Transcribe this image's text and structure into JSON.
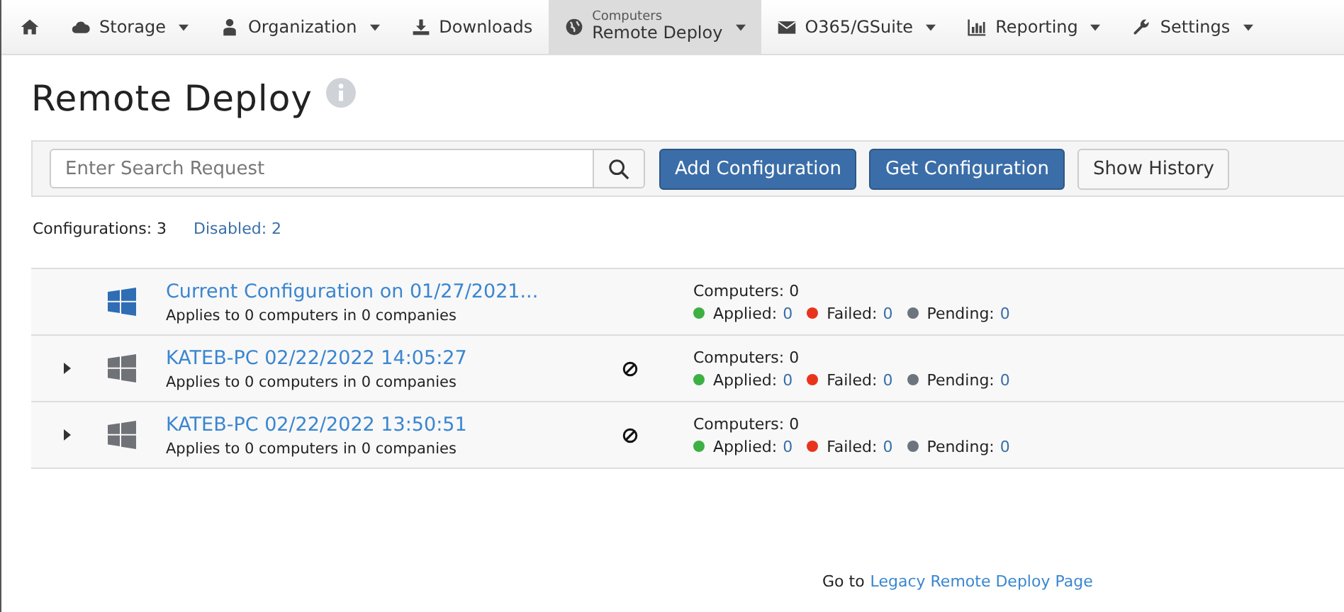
{
  "nav": [
    {
      "caret": false,
      "selected": false
    },
    {
      "label": "Storage",
      "caret": true,
      "selected": false
    },
    {
      "label": "Organization",
      "caret": true,
      "selected": false
    },
    {
      "label": "Downloads",
      "caret": false,
      "selected": false
    },
    {
      "sublabel": "Computers",
      "label": "Remote Deploy",
      "caret": true,
      "selected": true
    },
    {
      "label": "O365/GSuite",
      "caret": true,
      "selected": false
    },
    {
      "label": "Reporting",
      "caret": true,
      "selected": false
    },
    {
      "label": "Settings",
      "caret": true,
      "selected": false
    }
  ],
  "page": {
    "title": "Remote Deploy"
  },
  "toolbar": {
    "search": {
      "placeholder": "Enter Search Request"
    },
    "buttons": [
      {
        "label": "Add Configuration",
        "kind": "primary"
      },
      {
        "label": "Get Configuration",
        "kind": "primary"
      },
      {
        "label": "Show History",
        "kind": "default"
      }
    ]
  },
  "counts": {
    "configurations": "Configurations: 3",
    "disabled": "Disabled: 2"
  },
  "configs": [
    {
      "title": "Current Configuration on 01/27/2021...",
      "applies": "Applies to 0 computers in 0 companies",
      "expandable": false,
      "disabled": false,
      "computers": "Computers: 0",
      "statuses": [
        {
          "label": "Applied:",
          "count": "0",
          "color": "#3cb043"
        },
        {
          "label": "Failed:",
          "count": "0",
          "color": "#e8341c"
        },
        {
          "label": "Pending:",
          "count": "0",
          "color": "#6c757d"
        }
      ]
    },
    {
      "title": "KATEB-PC 02/22/2022 14:05:27",
      "applies": "Applies to 0 computers in 0 companies",
      "expandable": true,
      "disabled": true,
      "computers": "Computers: 0",
      "statuses": [
        {
          "label": "Applied:",
          "count": "0",
          "color": "#3cb043"
        },
        {
          "label": "Failed:",
          "count": "0",
          "color": "#e8341c"
        },
        {
          "label": "Pending:",
          "count": "0",
          "color": "#6c757d"
        }
      ]
    },
    {
      "title": "KATEB-PC 02/22/2022 13:50:51",
      "applies": "Applies to 0 computers in 0 companies",
      "expandable": true,
      "disabled": true,
      "computers": "Computers: 0",
      "statuses": [
        {
          "label": "Applied:",
          "count": "0",
          "color": "#3cb043"
        },
        {
          "label": "Failed:",
          "count": "0",
          "color": "#e8341c"
        },
        {
          "label": "Pending:",
          "count": "0",
          "color": "#6c757d"
        }
      ]
    }
  ],
  "footer": {
    "text": "Go to",
    "link": "Legacy Remote Deploy Page"
  }
}
